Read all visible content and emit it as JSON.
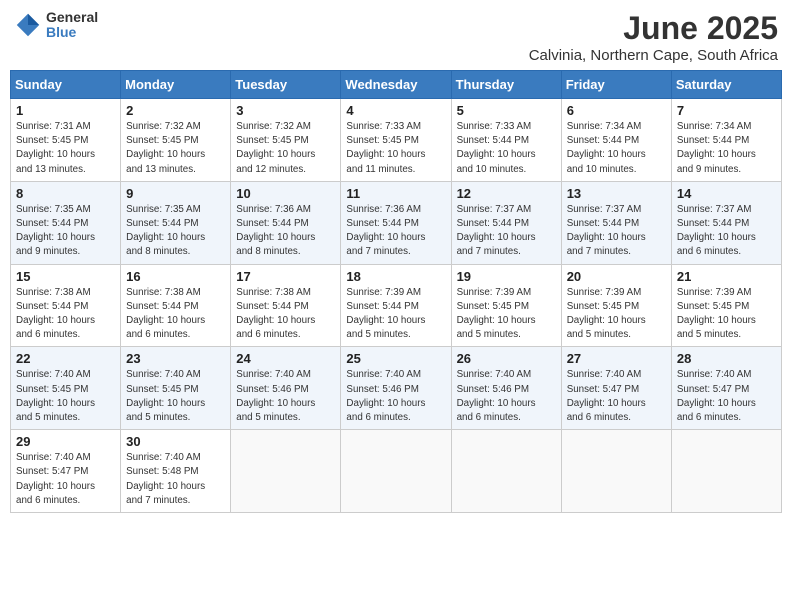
{
  "header": {
    "logo_line1": "General",
    "logo_line2": "Blue",
    "month": "June 2025",
    "location": "Calvinia, Northern Cape, South Africa"
  },
  "weekdays": [
    "Sunday",
    "Monday",
    "Tuesday",
    "Wednesday",
    "Thursday",
    "Friday",
    "Saturday"
  ],
  "weeks": [
    [
      {
        "day": "1",
        "info": "Sunrise: 7:31 AM\nSunset: 5:45 PM\nDaylight: 10 hours\nand 13 minutes."
      },
      {
        "day": "2",
        "info": "Sunrise: 7:32 AM\nSunset: 5:45 PM\nDaylight: 10 hours\nand 13 minutes."
      },
      {
        "day": "3",
        "info": "Sunrise: 7:32 AM\nSunset: 5:45 PM\nDaylight: 10 hours\nand 12 minutes."
      },
      {
        "day": "4",
        "info": "Sunrise: 7:33 AM\nSunset: 5:45 PM\nDaylight: 10 hours\nand 11 minutes."
      },
      {
        "day": "5",
        "info": "Sunrise: 7:33 AM\nSunset: 5:44 PM\nDaylight: 10 hours\nand 10 minutes."
      },
      {
        "day": "6",
        "info": "Sunrise: 7:34 AM\nSunset: 5:44 PM\nDaylight: 10 hours\nand 10 minutes."
      },
      {
        "day": "7",
        "info": "Sunrise: 7:34 AM\nSunset: 5:44 PM\nDaylight: 10 hours\nand 9 minutes."
      }
    ],
    [
      {
        "day": "8",
        "info": "Sunrise: 7:35 AM\nSunset: 5:44 PM\nDaylight: 10 hours\nand 9 minutes."
      },
      {
        "day": "9",
        "info": "Sunrise: 7:35 AM\nSunset: 5:44 PM\nDaylight: 10 hours\nand 8 minutes."
      },
      {
        "day": "10",
        "info": "Sunrise: 7:36 AM\nSunset: 5:44 PM\nDaylight: 10 hours\nand 8 minutes."
      },
      {
        "day": "11",
        "info": "Sunrise: 7:36 AM\nSunset: 5:44 PM\nDaylight: 10 hours\nand 7 minutes."
      },
      {
        "day": "12",
        "info": "Sunrise: 7:37 AM\nSunset: 5:44 PM\nDaylight: 10 hours\nand 7 minutes."
      },
      {
        "day": "13",
        "info": "Sunrise: 7:37 AM\nSunset: 5:44 PM\nDaylight: 10 hours\nand 7 minutes."
      },
      {
        "day": "14",
        "info": "Sunrise: 7:37 AM\nSunset: 5:44 PM\nDaylight: 10 hours\nand 6 minutes."
      }
    ],
    [
      {
        "day": "15",
        "info": "Sunrise: 7:38 AM\nSunset: 5:44 PM\nDaylight: 10 hours\nand 6 minutes."
      },
      {
        "day": "16",
        "info": "Sunrise: 7:38 AM\nSunset: 5:44 PM\nDaylight: 10 hours\nand 6 minutes."
      },
      {
        "day": "17",
        "info": "Sunrise: 7:38 AM\nSunset: 5:44 PM\nDaylight: 10 hours\nand 6 minutes."
      },
      {
        "day": "18",
        "info": "Sunrise: 7:39 AM\nSunset: 5:44 PM\nDaylight: 10 hours\nand 5 minutes."
      },
      {
        "day": "19",
        "info": "Sunrise: 7:39 AM\nSunset: 5:45 PM\nDaylight: 10 hours\nand 5 minutes."
      },
      {
        "day": "20",
        "info": "Sunrise: 7:39 AM\nSunset: 5:45 PM\nDaylight: 10 hours\nand 5 minutes."
      },
      {
        "day": "21",
        "info": "Sunrise: 7:39 AM\nSunset: 5:45 PM\nDaylight: 10 hours\nand 5 minutes."
      }
    ],
    [
      {
        "day": "22",
        "info": "Sunrise: 7:40 AM\nSunset: 5:45 PM\nDaylight: 10 hours\nand 5 minutes."
      },
      {
        "day": "23",
        "info": "Sunrise: 7:40 AM\nSunset: 5:45 PM\nDaylight: 10 hours\nand 5 minutes."
      },
      {
        "day": "24",
        "info": "Sunrise: 7:40 AM\nSunset: 5:46 PM\nDaylight: 10 hours\nand 5 minutes."
      },
      {
        "day": "25",
        "info": "Sunrise: 7:40 AM\nSunset: 5:46 PM\nDaylight: 10 hours\nand 6 minutes."
      },
      {
        "day": "26",
        "info": "Sunrise: 7:40 AM\nSunset: 5:46 PM\nDaylight: 10 hours\nand 6 minutes."
      },
      {
        "day": "27",
        "info": "Sunrise: 7:40 AM\nSunset: 5:47 PM\nDaylight: 10 hours\nand 6 minutes."
      },
      {
        "day": "28",
        "info": "Sunrise: 7:40 AM\nSunset: 5:47 PM\nDaylight: 10 hours\nand 6 minutes."
      }
    ],
    [
      {
        "day": "29",
        "info": "Sunrise: 7:40 AM\nSunset: 5:47 PM\nDaylight: 10 hours\nand 6 minutes."
      },
      {
        "day": "30",
        "info": "Sunrise: 7:40 AM\nSunset: 5:48 PM\nDaylight: 10 hours\nand 7 minutes."
      },
      {
        "day": "",
        "info": ""
      },
      {
        "day": "",
        "info": ""
      },
      {
        "day": "",
        "info": ""
      },
      {
        "day": "",
        "info": ""
      },
      {
        "day": "",
        "info": ""
      }
    ]
  ]
}
